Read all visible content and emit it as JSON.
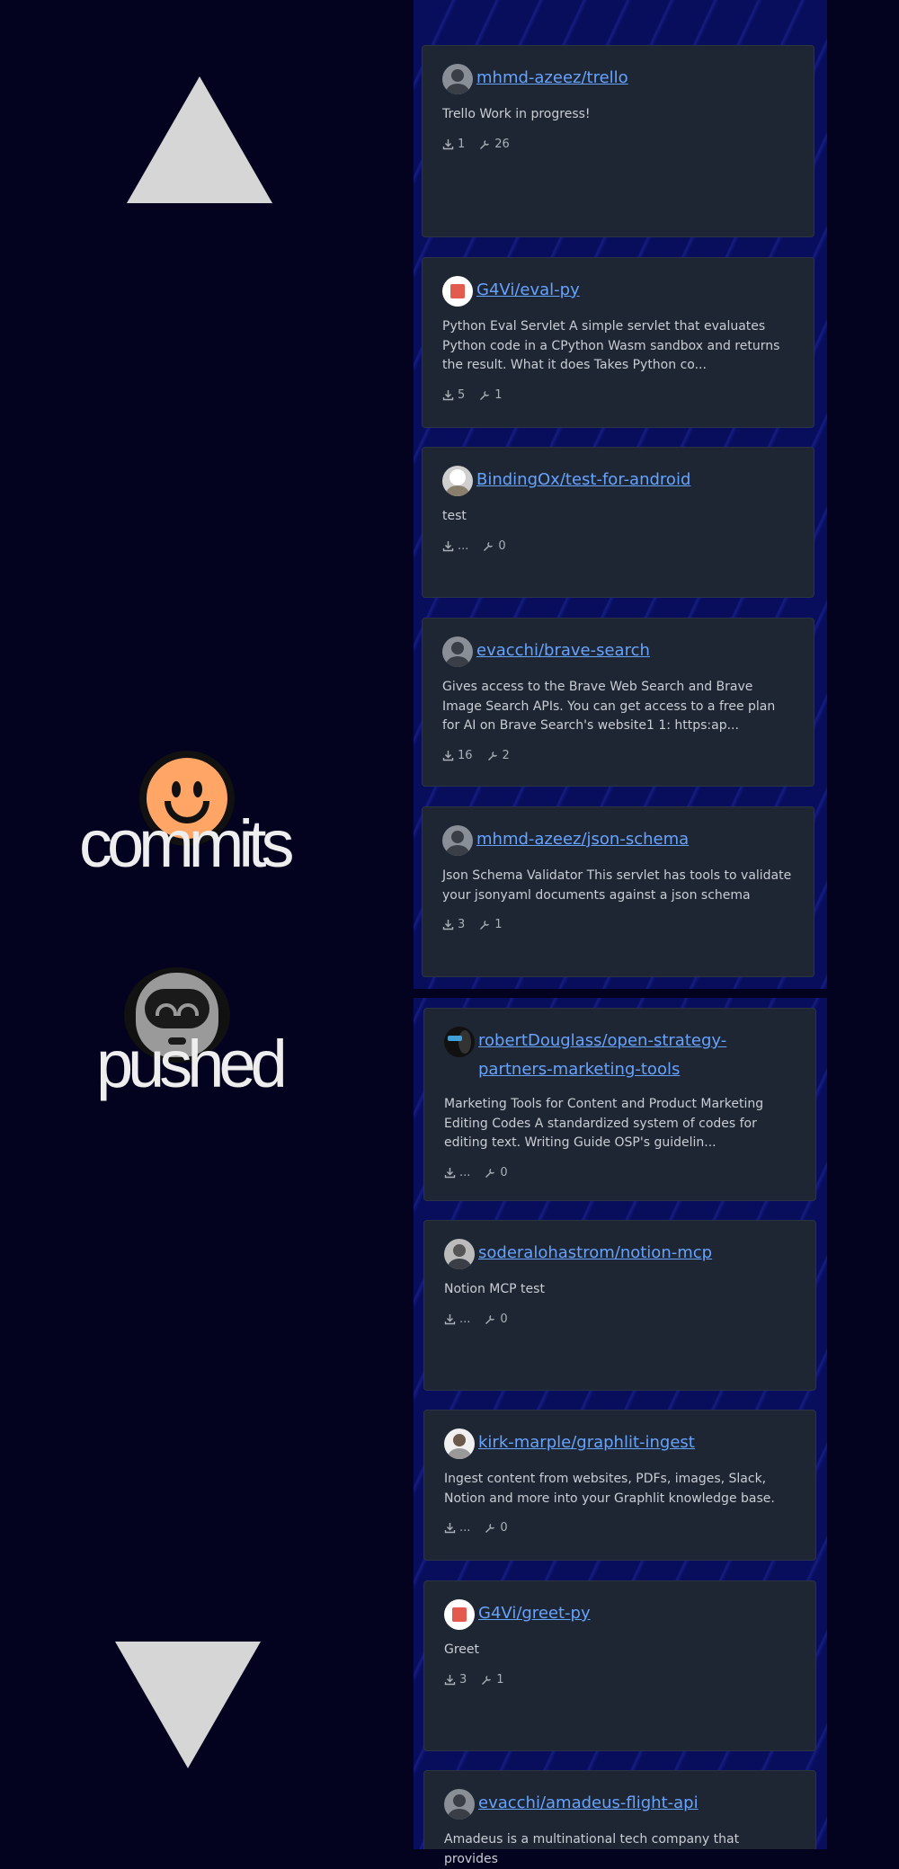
{
  "left": {
    "word_commits": "commits",
    "word_pushed": "pushed"
  },
  "cards": [
    {
      "repo": "mhmd-azeez/trello",
      "desc": "Trello Work in progress!",
      "downloads": "1",
      "tools": "26"
    },
    {
      "repo": "G4Vi/eval-py",
      "desc": "Python Eval Servlet A simple servlet that evaluates Python code in a CPython Wasm sandbox and returns the result. What it does Takes Python co...",
      "downloads": "5",
      "tools": "1"
    },
    {
      "repo": "BindingOx/test-for-android",
      "desc": "test",
      "downloads": "...",
      "tools": "0"
    },
    {
      "repo": "evacchi/brave-search",
      "desc": "Gives access to the Brave Web Search and Brave Image Search APIs. You can get access to a free plan for AI on Brave Search's website1 1: https:ap...",
      "downloads": "16",
      "tools": "2"
    },
    {
      "repo": "mhmd-azeez/json-schema",
      "desc": "Json Schema Validator This servlet has tools to validate your jsonyaml documents against a json schema",
      "downloads": "3",
      "tools": "1"
    },
    {
      "repo": "robertDouglass/open-strategy-partners-marketing-tools",
      "desc": "Marketing Tools for Content and Product Marketing Editing Codes A standardized system of codes for editing text. Writing Guide OSP's guidelin...",
      "downloads": "...",
      "tools": "0"
    },
    {
      "repo": "soderalohastrom/notion-mcp",
      "desc": "Notion MCP test",
      "downloads": "...",
      "tools": "0"
    },
    {
      "repo": "kirk-marple/graphlit-ingest",
      "desc": "Ingest content from websites, PDFs, images, Slack, Notion and more into your Graphlit knowledge base.",
      "downloads": "...",
      "tools": "0"
    },
    {
      "repo": "G4Vi/greet-py",
      "desc": "Greet",
      "downloads": "3",
      "tools": "1"
    },
    {
      "repo": "evacchi/amadeus-flight-api",
      "desc": "Amadeus is a multinational tech company that provides",
      "downloads": "",
      "tools": ""
    }
  ]
}
